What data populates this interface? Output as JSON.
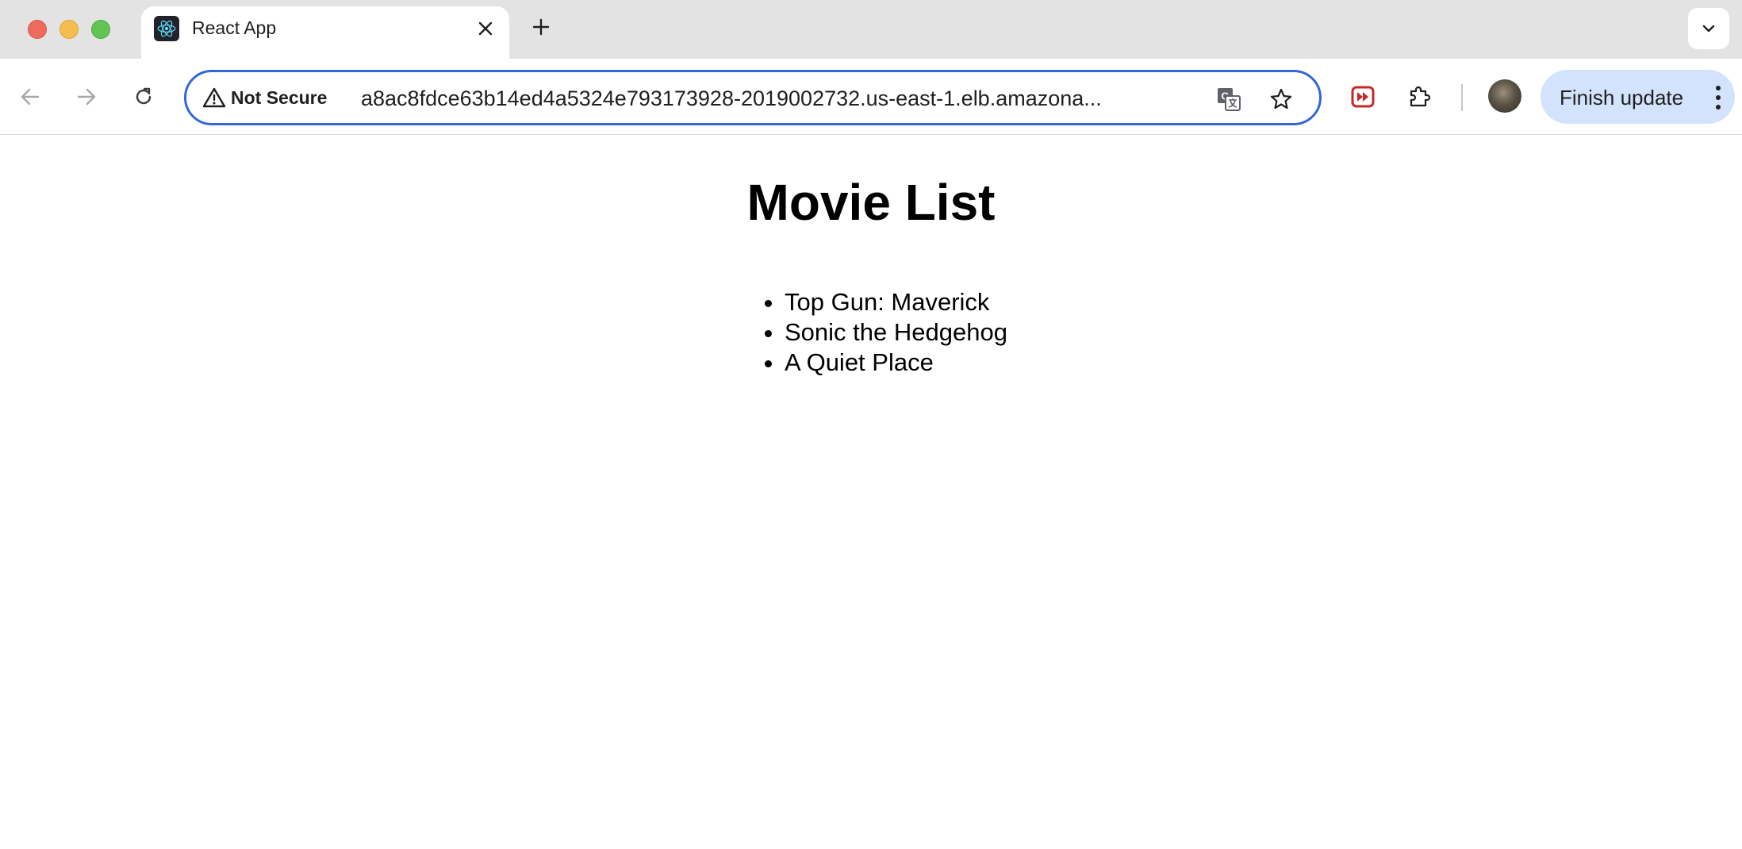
{
  "browser": {
    "tab": {
      "title": "React App",
      "favicon": "react-icon"
    },
    "address_bar": {
      "security_label": "Not Secure",
      "url": "a8ac8fdce63b14ed4a5324e793173928-2019002732.us-east-1.elb.amazona..."
    },
    "update_button_label": "Finish update",
    "icons": {
      "back": "arrow-left-icon",
      "forward": "arrow-right-icon",
      "reload": "reload-icon",
      "translate": "translate-icon",
      "bookmark": "star-icon",
      "extension_video": "video-speed-extension-icon",
      "extensions": "puzzle-icon",
      "menu": "more-vertical-icon"
    },
    "colors": {
      "focus_ring": "#3367d6",
      "update_button_bg": "#d3e3fd",
      "tabstrip_bg": "#e3e3e3"
    }
  },
  "page": {
    "heading": "Movie List",
    "movies": [
      "Top Gun: Maverick",
      "Sonic the Hedgehog",
      "A Quiet Place"
    ]
  }
}
